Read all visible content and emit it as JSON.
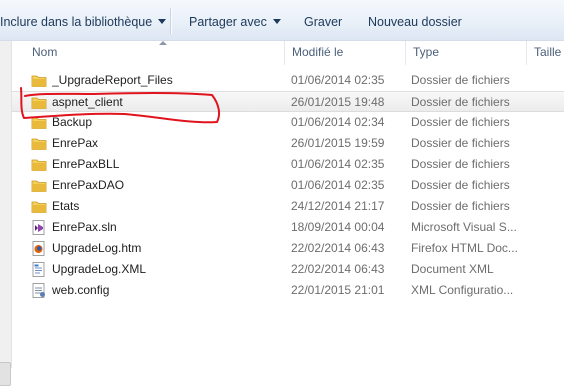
{
  "toolbar": {
    "include_library": "Inclure dans la bibliothèque",
    "share_with": "Partager avec",
    "burn": "Graver",
    "new_folder": "Nouveau dossier"
  },
  "columns": {
    "name": "Nom",
    "modified": "Modifié le",
    "type": "Type",
    "size": "Taille"
  },
  "files": [
    {
      "name": "_UpgradeReport_Files",
      "date": "01/06/2014 02:35",
      "type": "Dossier de fichiers",
      "icon": "folder-icon"
    },
    {
      "name": "aspnet_client",
      "date": "26/01/2015 19:48",
      "type": "Dossier de fichiers",
      "icon": "folder-icon"
    },
    {
      "name": "Backup",
      "date": "01/06/2014 02:34",
      "type": "Dossier de fichiers",
      "icon": "folder-icon"
    },
    {
      "name": "EnrePax",
      "date": "26/01/2015 19:59",
      "type": "Dossier de fichiers",
      "icon": "folder-icon"
    },
    {
      "name": "EnrePaxBLL",
      "date": "01/06/2014 02:35",
      "type": "Dossier de fichiers",
      "icon": "folder-icon"
    },
    {
      "name": "EnrePaxDAO",
      "date": "01/06/2014 02:35",
      "type": "Dossier de fichiers",
      "icon": "folder-icon"
    },
    {
      "name": "Etats",
      "date": "24/12/2014 21:17",
      "type": "Dossier de fichiers",
      "icon": "folder-icon"
    },
    {
      "name": "EnrePax.sln",
      "date": "18/09/2014 00:04",
      "type": "Microsoft Visual S...",
      "icon": "visual-studio-solution-icon"
    },
    {
      "name": "UpgradeLog.htm",
      "date": "22/02/2014 06:43",
      "type": "Firefox HTML Doc...",
      "icon": "firefox-html-icon"
    },
    {
      "name": "UpgradeLog.XML",
      "date": "22/02/2014 06:43",
      "type": "Document XML",
      "icon": "xml-document-icon"
    },
    {
      "name": "web.config",
      "date": "22/01/2015 21:01",
      "type": "XML Configuratio...",
      "icon": "config-file-icon"
    }
  ],
  "colors": {
    "folder": "#e8b93b",
    "annotation": "#e0141e",
    "link_text": "#1e395b"
  }
}
